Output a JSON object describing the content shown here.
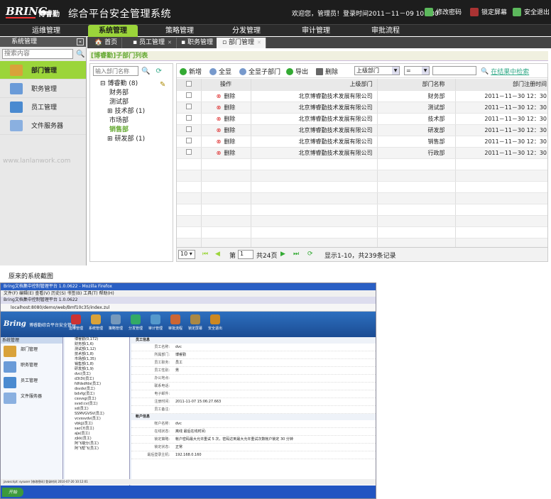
{
  "header": {
    "logo_text": "BRING",
    "logo_cn": "博睿勤",
    "system_title": "综合平台安全管理系统",
    "welcome": "欢迎您，管理员！登录时间2011－11－09 10：30",
    "btn_change_password": "修改密码",
    "btn_lock_screen": "锁定屏幕",
    "btn_logout": "安全退出"
  },
  "nav": [
    "运维管理",
    "系统管理",
    "策略管理",
    "分发管理",
    "审计管理",
    "审批流程"
  ],
  "nav_active": 1,
  "sidebar": {
    "title": "系统管理",
    "search_placeholder": "搜索内容",
    "items": [
      {
        "label": "部门管理",
        "active": true
      },
      {
        "label": "职务管理",
        "active": false
      },
      {
        "label": "员工管理",
        "active": false
      },
      {
        "label": "文件服务器",
        "active": false
      }
    ],
    "watermark": "www.lanlanwork.com"
  },
  "tabs": [
    {
      "label": "首页"
    },
    {
      "label": "员工管理"
    },
    {
      "label": "职务管理"
    },
    {
      "label": "部门管理",
      "active": true
    }
  ],
  "page_title": "[博睿勤]子部门列表",
  "tree": {
    "search_placeholder": "输入部门名称",
    "nodes": [
      {
        "label": "博睿勤 (8)",
        "level": 0,
        "toggle": "⊟"
      },
      {
        "label": "财务部",
        "level": 1,
        "toggle": ""
      },
      {
        "label": "测试部",
        "level": 1,
        "toggle": ""
      },
      {
        "label": "技术部 (1)",
        "level": 1,
        "toggle": "⊞"
      },
      {
        "label": "市场部",
        "level": 1,
        "toggle": ""
      },
      {
        "label": "销售部",
        "level": 1,
        "toggle": "",
        "highlight": true
      },
      {
        "label": "研发部 (1)",
        "level": 1,
        "toggle": "⊞"
      }
    ]
  },
  "toolbar": {
    "new": "新增",
    "all": "全显",
    "all_sub": "全显子部门",
    "export": "导出",
    "delete": "删除",
    "filter_field": "上级部门",
    "filter_op": "=",
    "filter_value": "",
    "search_in_results": "在结果中检索"
  },
  "table": {
    "headers": [
      "操作",
      "上级部门",
      "部门名称",
      "部门注册时间"
    ],
    "delete_label": "删除",
    "rows": [
      {
        "parent": "北京博睿勤技术发展有限公司",
        "name": "财务部",
        "time": "2011－11－30 12：30"
      },
      {
        "parent": "北京博睿勤技术发展有限公司",
        "name": "测试部",
        "time": "2011－11－30 12：30"
      },
      {
        "parent": "北京博睿勤技术发展有限公司",
        "name": "技术部",
        "time": "2011－11－30 12：30"
      },
      {
        "parent": "北京博睿勤技术发展有限公司",
        "name": "研发部",
        "time": "2011－11－30 12：30"
      },
      {
        "parent": "北京博睿勤技术发展有限公司",
        "name": "销售部",
        "time": "2011－11－30 12：30"
      },
      {
        "parent": "北京博睿勤技术发展有限公司",
        "name": "行政部",
        "time": "2011－11－30 12：30"
      }
    ]
  },
  "pager": {
    "page_size": "10",
    "page_label": "第",
    "page": "1",
    "total_pages": "共24页",
    "summary": "显示1-10，共239条记录"
  },
  "caption": "原来的系统截图",
  "old": {
    "window_title": "Bring文档集中控制管理平台 1.0.0622 - Mozilla Firefox",
    "menu": "文件(F)  编辑(E)  查看(V)  历史(S)  书签(B)  工具(T)  帮助(H)",
    "tab": "Bring文档集中控制管理平台 1.0.0622",
    "address": "localhost:8080/demo/web/Bmf10c35/index.zul",
    "logo": "Bring",
    "sys": "博睿勤综合平台安全管理",
    "icons": [
      "运维管理",
      "系统管理",
      "策略管理",
      "分发管理",
      "审计管理",
      "审批流程",
      "锁定屏幕",
      "安全退出"
    ],
    "left_title": "系统管理",
    "left_items": [
      "部门管理",
      "职务管理",
      "员工管理",
      "文件服务器"
    ],
    "tree_items": [
      "博睿勤(0,172)",
      "财务部(1,6)",
      "测试部(1,12)",
      "技术部(1,8)",
      "市场部(1,35)",
      "销售部(1,8)",
      "研发部(1,9)",
      "dvc(员工)",
      "d3t3t(员工)",
      "fdfdsdfds(员工)",
      "dsvdv(员工)",
      "bdvfg(员工)",
      "cssvsg(员工)",
      "svsd:cv(员工)",
      "sd(员工)",
      "SSMVGVSV(员工)",
      "vcvssvdv(员工)",
      "vbkjj(员工)",
      "sacCf(员工)",
      "aJa(员工)",
      "zjkk(员工)",
      "阿飞端分(员工)",
      "阿飞帮飞(员工)"
    ],
    "form_sections": [
      "员工信息",
      "帐户信息"
    ],
    "form_rows": [
      {
        "k": "员工名称:",
        "v": "dvc"
      },
      {
        "k": "所属部门:",
        "v": "博睿勤"
      },
      {
        "k": "员工职务:",
        "v": "员工"
      },
      {
        "k": "员工性别:",
        "v": "男"
      },
      {
        "k": "办公地点:",
        "v": ""
      },
      {
        "k": "联系电话:",
        "v": ""
      },
      {
        "k": "电子邮件:",
        "v": ""
      },
      {
        "k": "注册时间:",
        "v": "2011-11-07 15:06:27.663"
      },
      {
        "k": "员工备注:",
        "v": ""
      }
    ],
    "account_rows": [
      {
        "k": "帐户名称:",
        "v": "dvc"
      },
      {
        "k": "在线状态:",
        "v": "离线  最后在线时间:"
      },
      {
        "k": "锁定策略:",
        "v": "帐户密码最大允许重试 5 次，密码达到最大允许重试次数帐户锁定 30 分钟"
      },
      {
        "k": "锁定状态:",
        "v": "正常"
      },
      {
        "k": "最后登录主机:",
        "v": "192.168.0.160"
      }
    ],
    "status": "javascript:  sysuser [修改密码] 登录时间 2010-07-20 10:12:01",
    "start": "开始"
  }
}
